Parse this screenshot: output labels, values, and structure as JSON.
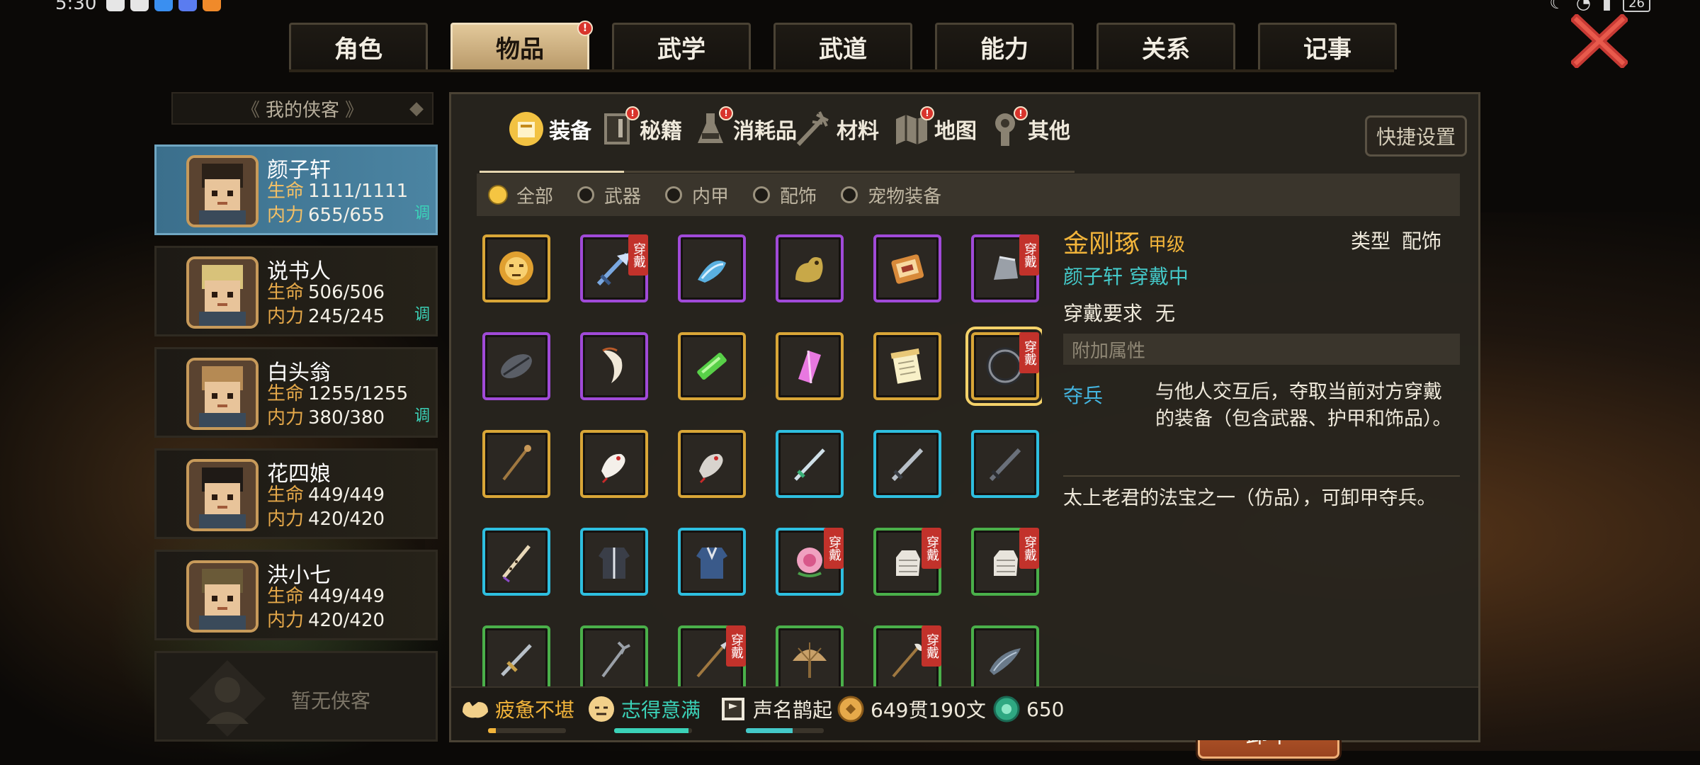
{
  "status_bar": {
    "time": "5:30",
    "battery": "26"
  },
  "tabs": [
    {
      "label": "角色",
      "active": false,
      "badge": false
    },
    {
      "label": "物品",
      "active": true,
      "badge": true
    },
    {
      "label": "武学",
      "active": false,
      "badge": false
    },
    {
      "label": "武道",
      "active": false,
      "badge": false
    },
    {
      "label": "能力",
      "active": false,
      "badge": false
    },
    {
      "label": "关系",
      "active": false,
      "badge": false
    },
    {
      "label": "记事",
      "active": false,
      "badge": false
    }
  ],
  "badge_mark": "!",
  "left_panel": {
    "title": "我的侠客",
    "empty_label": "暂无侠客",
    "stat_life_label": "生命",
    "stat_inner_label": "内力",
    "adjust_label": "调",
    "heroes": [
      {
        "name": "颜子轩",
        "life": "1111/1111",
        "inner": "655/655",
        "adjust": true,
        "selected": true
      },
      {
        "name": "说书人",
        "life": "506/506",
        "inner": "245/245",
        "adjust": true,
        "selected": false
      },
      {
        "name": "白头翁",
        "life": "1255/1255",
        "inner": "380/380",
        "adjust": true,
        "selected": false
      },
      {
        "name": "花四娘",
        "life": "449/449",
        "inner": "420/420",
        "adjust": false,
        "selected": false
      },
      {
        "name": "洪小七",
        "life": "449/449",
        "inner": "420/420",
        "adjust": false,
        "selected": false
      }
    ]
  },
  "subtabs": [
    {
      "label": "装备",
      "active": true,
      "badge": false
    },
    {
      "label": "秘籍",
      "active": false,
      "badge": true
    },
    {
      "label": "消耗品",
      "active": false,
      "badge": true
    },
    {
      "label": "材料",
      "active": false,
      "badge": false
    },
    {
      "label": "地图",
      "active": false,
      "badge": true
    },
    {
      "label": "其他",
      "active": false,
      "badge": true
    }
  ],
  "quick_settings_label": "快捷设置",
  "filters": [
    {
      "label": "全部",
      "active": true
    },
    {
      "label": "武器",
      "active": false
    },
    {
      "label": "内甲",
      "active": false
    },
    {
      "label": "配饰",
      "active": false
    },
    {
      "label": "宠物装备",
      "active": false
    }
  ],
  "worn_label": "穿戴",
  "items": [
    {
      "icon": "golden-mask-icon",
      "quality": "gold",
      "worn": false
    },
    {
      "icon": "blue-fan-icon",
      "quality": "purple",
      "worn": true
    },
    {
      "icon": "blue-hat-icon",
      "quality": "purple",
      "worn": false
    },
    {
      "icon": "golden-beast-icon",
      "quality": "purple",
      "worn": false
    },
    {
      "icon": "scroll-box-icon",
      "quality": "purple",
      "worn": false
    },
    {
      "icon": "gray-bell-icon",
      "quality": "purple",
      "worn": true
    },
    {
      "icon": "dark-leaf-icon",
      "quality": "purple",
      "worn": false
    },
    {
      "icon": "fang-necklace-icon",
      "quality": "purple",
      "worn": false
    },
    {
      "icon": "green-jade-icon",
      "quality": "gold",
      "worn": false
    },
    {
      "icon": "pink-crystal-icon",
      "quality": "gold",
      "worn": false
    },
    {
      "icon": "book-scroll-icon",
      "quality": "gold",
      "worn": false
    },
    {
      "icon": "iron-ring-icon",
      "quality": "gold",
      "worn": true,
      "selected": true
    },
    {
      "icon": "wooden-staff-icon",
      "quality": "gold",
      "worn": false
    },
    {
      "icon": "white-bird-icon",
      "quality": "gold",
      "worn": false
    },
    {
      "icon": "gray-bird-icon",
      "quality": "gold",
      "worn": false
    },
    {
      "icon": "jade-sword-icon",
      "quality": "blue",
      "worn": false
    },
    {
      "icon": "steel-sword-icon",
      "quality": "blue",
      "worn": false
    },
    {
      "icon": "dark-sword-icon",
      "quality": "blue",
      "worn": false
    },
    {
      "icon": "flute-icon",
      "quality": "blue",
      "worn": false
    },
    {
      "icon": "dark-robe-icon",
      "quality": "blue",
      "worn": false
    },
    {
      "icon": "blue-robe-icon",
      "quality": "blue",
      "worn": false
    },
    {
      "icon": "pink-peony-icon",
      "quality": "blue",
      "worn": true
    },
    {
      "icon": "white-glove-icon",
      "quality": "green",
      "worn": true
    },
    {
      "icon": "white-glove-icon",
      "quality": "green",
      "worn": true
    },
    {
      "icon": "short-sword-icon",
      "quality": "green",
      "worn": false
    },
    {
      "icon": "trident-icon",
      "quality": "green",
      "worn": false
    },
    {
      "icon": "spear-icon",
      "quality": "green",
      "worn": true
    },
    {
      "icon": "palm-fan-icon",
      "quality": "green",
      "worn": false
    },
    {
      "icon": "brush-spear-icon",
      "quality": "green",
      "worn": true
    },
    {
      "icon": "horn-icon",
      "quality": "green",
      "worn": false
    }
  ],
  "detail": {
    "name": "金刚琢",
    "grade": "甲级",
    "type_label": "类型",
    "type_value": "配饰",
    "owner": "颜子轩 穿戴中",
    "requirement_label": "穿戴要求",
    "requirement_value": "无",
    "attr_header": "附加属性",
    "attr_name": "夺兵",
    "attr_desc": "与他人交互后，夺取当前对方穿戴的装备（包含武器、护甲和饰品）。",
    "description": "太上老君的法宝之一（仿品），可卸甲夺兵。",
    "unequip_label": "卸下"
  },
  "bottom_bar": {
    "fatigue": {
      "label": "疲惫不堪",
      "level": 0.1
    },
    "mood": {
      "label": "志得意满",
      "level": 0.95
    },
    "fame": {
      "label": "声名鹊起",
      "level": 0.6
    },
    "money": "649贯190文",
    "jade": "650"
  },
  "colors": {
    "gold": "#d9a637",
    "purple": "#a04ad8",
    "blue": "#2ebfe0",
    "green": "#4ab04a",
    "worn_badge": "#c2322b",
    "fatigue_text": "#f2b43a",
    "mood_text": "#3bd2b8"
  }
}
